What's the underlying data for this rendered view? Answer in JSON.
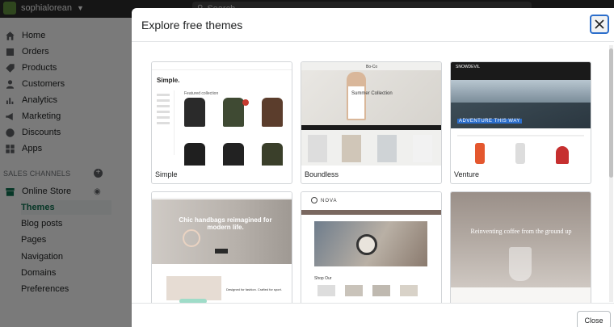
{
  "store": {
    "name": "sophialorean"
  },
  "search": {
    "placeholder": "Search"
  },
  "nav": [
    {
      "label": "Home",
      "icon": "home-icon"
    },
    {
      "label": "Orders",
      "icon": "orders-icon"
    },
    {
      "label": "Products",
      "icon": "products-icon"
    },
    {
      "label": "Customers",
      "icon": "customers-icon"
    },
    {
      "label": "Analytics",
      "icon": "analytics-icon"
    },
    {
      "label": "Marketing",
      "icon": "marketing-icon"
    },
    {
      "label": "Discounts",
      "icon": "discounts-icon"
    },
    {
      "label": "Apps",
      "icon": "apps-icon"
    }
  ],
  "sales_channels": {
    "title": "SALES CHANNELS",
    "online_store": "Online Store",
    "sub_items": [
      "Themes",
      "Blog posts",
      "Pages",
      "Navigation",
      "Domains",
      "Preferences"
    ],
    "active": "Themes"
  },
  "modal": {
    "title": "Explore free themes",
    "close_label": "Close",
    "themes": [
      {
        "name": "Simple",
        "logo": "Simple.",
        "heading": "Featured collection",
        "icon": "simple-theme-preview"
      },
      {
        "name": "Boundless",
        "brand": "Bo-Co",
        "heading": "Summer Collection",
        "icon": "boundless-theme-preview"
      },
      {
        "name": "Venture",
        "brand": "SNOWDEVIL",
        "heading": "ADVENTURE THIS WAY",
        "icon": "venture-theme-preview"
      },
      {
        "name": "",
        "heading": "Chic handbags reimagined for modern life.",
        "subtext": "Designed for fashion. Crafted for sport.",
        "icon": "handbags-theme-preview"
      },
      {
        "name": "",
        "brand": "NOVA",
        "subtext": "Shop Our",
        "icon": "nova-theme-preview"
      },
      {
        "name": "",
        "heading": "Reinventing coffee from the ground up",
        "icon": "coffee-theme-preview"
      }
    ]
  },
  "colors": {
    "accent": "#2c6ecb",
    "active_nav": "#0e6e4f",
    "brand": "#5f8d3c"
  }
}
